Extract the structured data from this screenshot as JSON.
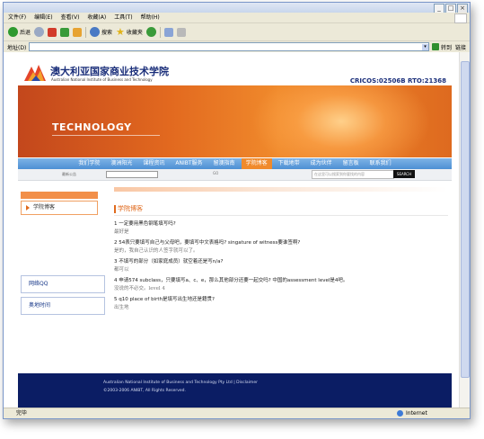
{
  "window": {
    "min": "_",
    "max": "□",
    "close": "×"
  },
  "menubar": {
    "items": [
      "文件(F)",
      "编辑(E)",
      "查看(V)",
      "收藏(A)",
      "工具(T)",
      "帮助(H)"
    ]
  },
  "toolbar": {
    "back": "后退",
    "search": "搜索",
    "favorites": "收藏夹"
  },
  "address": {
    "label": "地址(D)",
    "go": "转到",
    "links": "链接"
  },
  "site": {
    "logo_cn": "澳大利亚国家商业技术学院",
    "logo_en": "Australian National Institute of Business and Technology",
    "cricos": "CRICOS:02506B  RTO:21368",
    "banner_text": "TECHNOLOGY",
    "nav": [
      "我们学院",
      "澳洲阳光",
      "课程资讯",
      "ANIBT服务",
      "留澳指南",
      "学院博客",
      "下载地带",
      "成为伙伴",
      "留言板",
      "联系我们"
    ],
    "nav_active": "学院博客",
    "subbar": {
      "label": "最新公告",
      "go": "GO",
      "search_placeholder": "在这里可以搜索到你要找的内容",
      "search_btn": "SEARCH"
    },
    "sidebar": {
      "item": "学院博客",
      "box1": "网络QQ",
      "box2": "奥地时间"
    },
    "content": {
      "title": "学院博客",
      "qa": [
        {
          "q": "1 一定要用黑色钢笔填写吗?",
          "a": "最好是"
        },
        {
          "q": "2 54表只要填写自己与父母吧，要填写中文表格吗? singature of witness要谁签啊?",
          "a": "是的，我自己认识的人签字就可以了。"
        },
        {
          "q": "3 不填写的部分（如家庭成员）就空着还是写n/a?",
          "a": "都可以"
        },
        {
          "q": "4 申请574 subclass，只要填写a、c、e，那么其他部分还要一起交吗? 中国的assessment level是4吧。",
          "a": "没说的不必交。level 4"
        },
        {
          "q": "5 q10 place of birth是填写出生地还是籍贯?",
          "a": "出生地"
        }
      ]
    },
    "footer": {
      "line1": "Australian National Institute of Business and Technology Pty Ltd | Disclaimer",
      "line2": "©2003-2006 ANIBT, All Rights Reserved."
    }
  },
  "status": {
    "left": "完毕",
    "right": "Internet"
  },
  "colors": {
    "accent_orange": "#e06a1d",
    "nav_blue": "#4d8fd4",
    "footer_navy": "#0b1d64"
  }
}
